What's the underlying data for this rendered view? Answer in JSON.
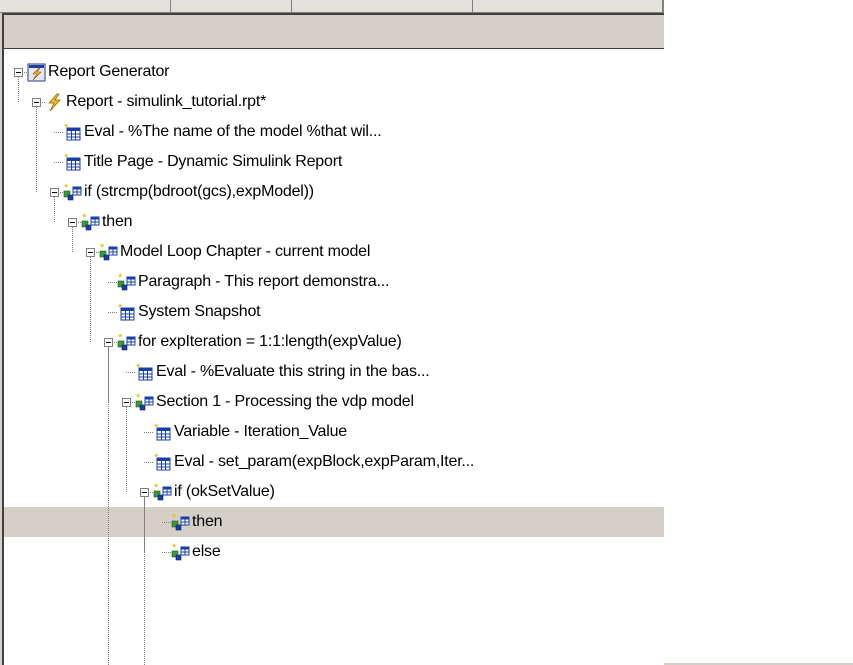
{
  "tree": {
    "nodes": [
      {
        "label": "Report Generator",
        "icon": "report-generator-icon",
        "selected": false
      },
      {
        "label": "Report - simulink_tutorial.rpt*",
        "icon": "report-lightning-icon",
        "selected": false
      },
      {
        "label": "Eval - %The name of the model %that wil...",
        "icon": "table-component-icon",
        "selected": false
      },
      {
        "label": "Title Page - Dynamic Simulink Report",
        "icon": "table-component-icon",
        "selected": false
      },
      {
        "label": "if (strcmp(bdroot(gcs),expModel))",
        "icon": "logic-component-icon",
        "selected": false
      },
      {
        "label": "then",
        "icon": "logic-component-icon",
        "selected": false
      },
      {
        "label": "Model Loop Chapter - current model",
        "icon": "logic-component-icon",
        "selected": false
      },
      {
        "label": "Paragraph - This report demonstra...",
        "icon": "logic-component-icon",
        "selected": false
      },
      {
        "label": "System Snapshot",
        "icon": "table-component-icon",
        "selected": false
      },
      {
        "label": "for expIteration = 1:1:length(expValue)",
        "icon": "logic-component-icon",
        "selected": false
      },
      {
        "label": "Eval - %Evaluate this string in the bas...",
        "icon": "table-component-icon",
        "selected": false
      },
      {
        "label": "Section 1 - Processing the vdp model",
        "icon": "logic-component-icon",
        "selected": false
      },
      {
        "label": "Variable - Iteration_Value",
        "icon": "table-component-icon",
        "selected": false
      },
      {
        "label": "Eval - set_param(expBlock,expParam,Iter...",
        "icon": "table-component-icon",
        "selected": false
      },
      {
        "label": "if (okSetValue)",
        "icon": "logic-component-icon",
        "selected": false
      },
      {
        "label": "then",
        "icon": "logic-component-icon",
        "selected": true
      },
      {
        "label": "else",
        "icon": "logic-component-icon",
        "selected": false
      }
    ]
  },
  "colors": {
    "selection": "#d4d0c8",
    "lightning_gold": "#f0c020",
    "icon_blue": "#1a3fa8",
    "icon_green": "#3a9a3a"
  }
}
